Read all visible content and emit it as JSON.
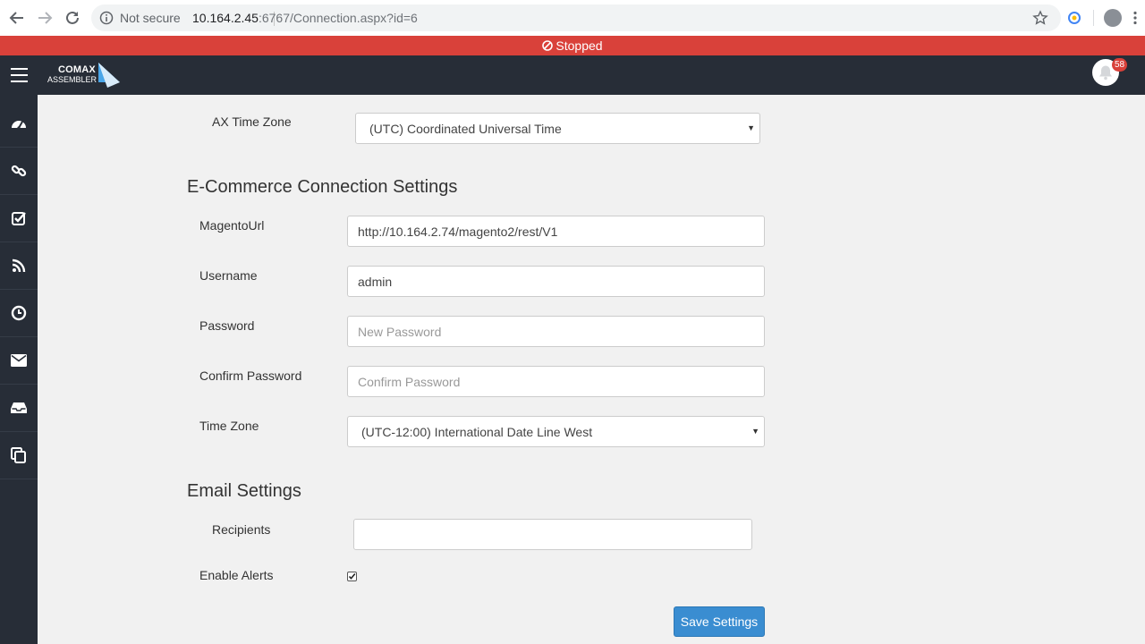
{
  "browser": {
    "security_label": "Not secure",
    "url_host": "10.164.2.45",
    "url_path": ":6767/Connection.aspx?id=6"
  },
  "status": {
    "label": "Stopped",
    "color": "#d9413a"
  },
  "header": {
    "logo_line1": "COMAX",
    "logo_line2": "ASSEMBLER",
    "notification_count": "58"
  },
  "sidebar": {
    "items": [
      {
        "icon": "dashboard-icon"
      },
      {
        "icon": "link-icon"
      },
      {
        "icon": "checklist-icon"
      },
      {
        "icon": "rss-feed-icon"
      },
      {
        "icon": "clock-icon"
      },
      {
        "icon": "envelope-icon"
      },
      {
        "icon": "inbox-icon"
      },
      {
        "icon": "copy-icon"
      }
    ]
  },
  "ax": {
    "timezone_label": "AX Time Zone",
    "timezone_value": "(UTC) Coordinated Universal Time"
  },
  "ecommerce": {
    "title": "E-Commerce Connection Settings",
    "magento_label": "MagentoUrl",
    "magento_value": "http://10.164.2.74/magento2/rest/V1",
    "username_label": "Username",
    "username_value": "admin",
    "password_label": "Password",
    "password_placeholder": "New Password",
    "confirm_label": "Confirm Password",
    "confirm_placeholder": "Confirm Password",
    "timezone_label": "Time Zone",
    "timezone_value": "(UTC-12:00) International Date Line West"
  },
  "email": {
    "title": "Email Settings",
    "recipients_label": "Recipients",
    "recipients_value": "",
    "alerts_label": "Enable Alerts",
    "alerts_checked": true
  },
  "actions": {
    "save_label": "Save Settings",
    "save_color": "#3a8dd1"
  }
}
